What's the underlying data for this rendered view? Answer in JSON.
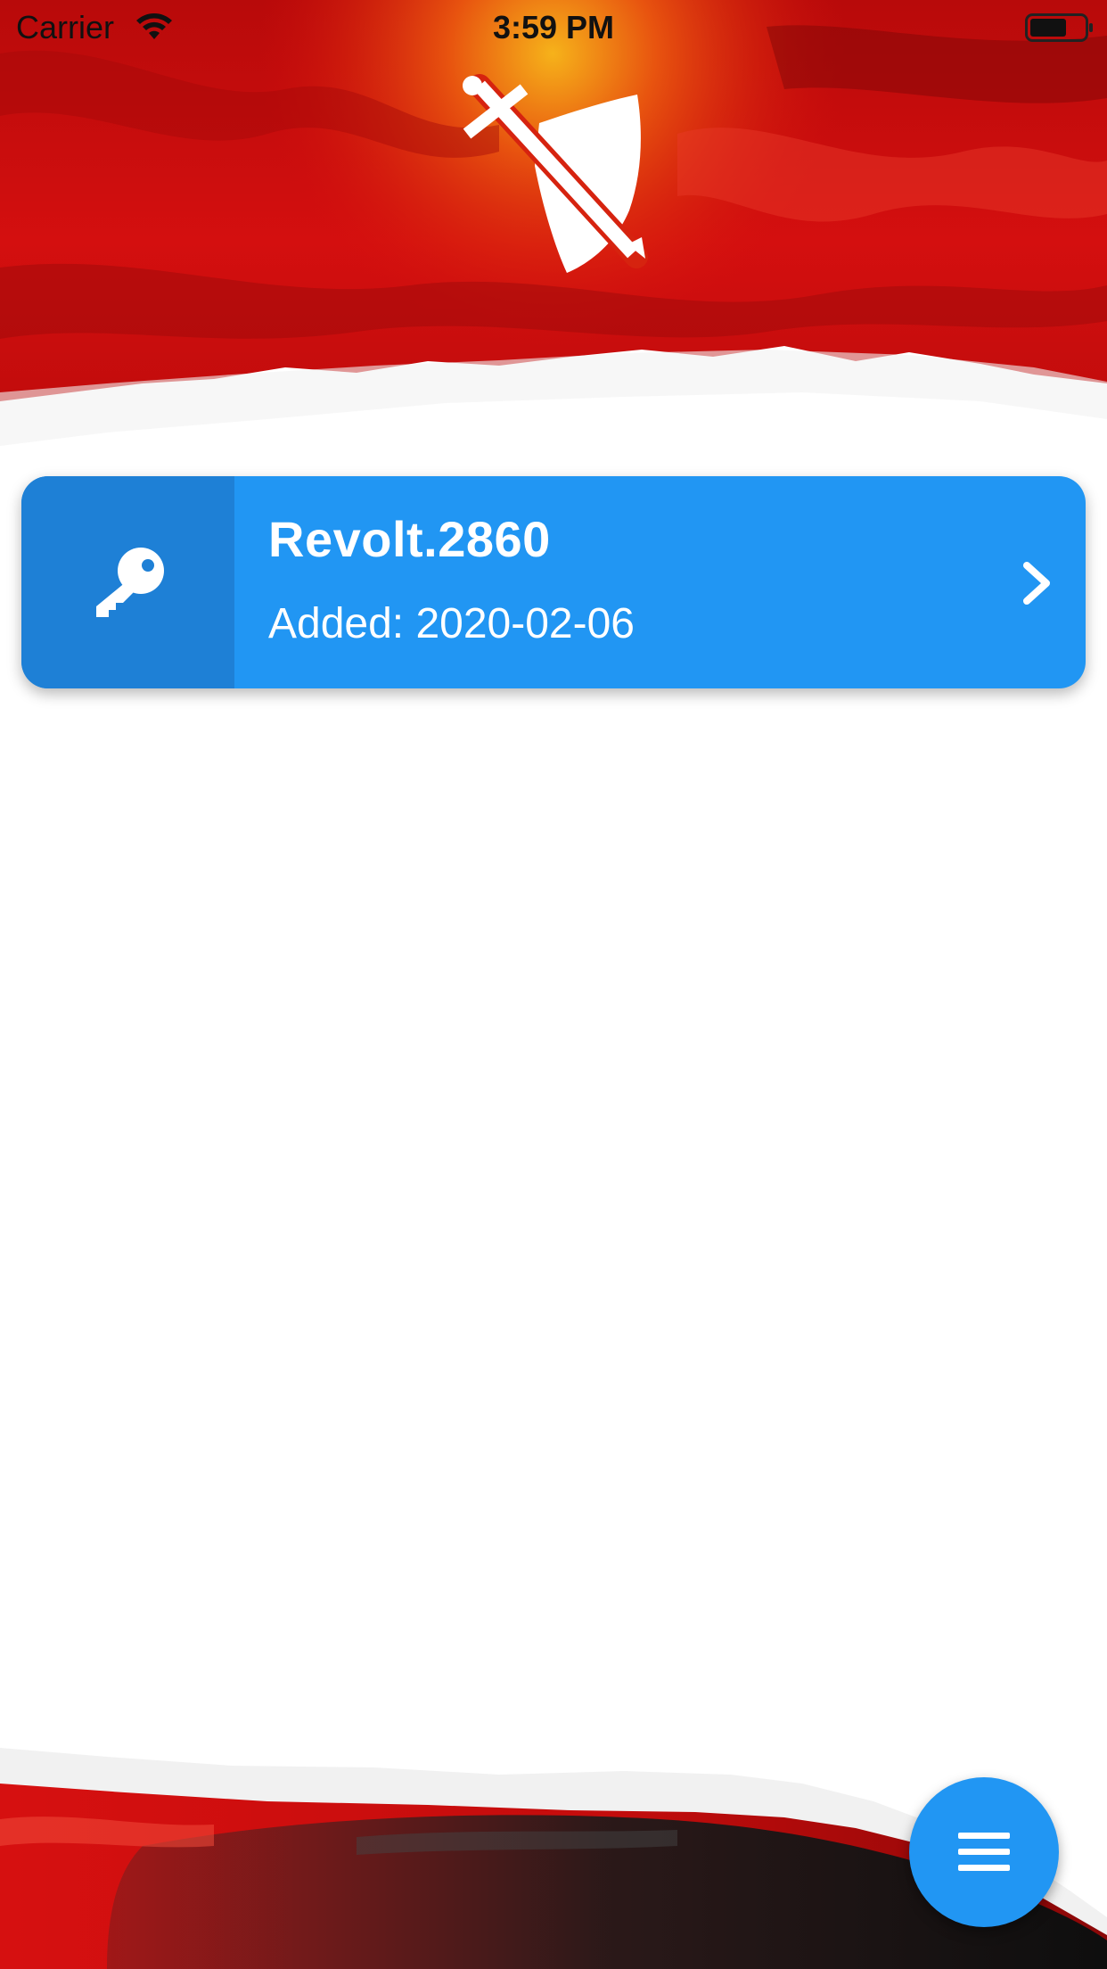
{
  "status_bar": {
    "carrier": "Carrier",
    "time": "3:59 PM",
    "wifi_icon": "wifi-icon",
    "battery_icon": "battery-icon"
  },
  "header": {
    "logo_icon": "shield-sword-icon"
  },
  "accounts": [
    {
      "name": "Revolt.2860",
      "added": "Added: 2020-02-06",
      "icon": "key-icon",
      "action_icon": "chevron-right-icon"
    }
  ],
  "fab": {
    "icon": "menu-icon"
  },
  "colors": {
    "primary": "#2196f3",
    "icon_panel": "#1e80d6",
    "header_red": "#d40d0d",
    "header_accent": "#f08a12",
    "footer_dark": "#1a1a1a",
    "text_on_primary": "#ffffff"
  }
}
